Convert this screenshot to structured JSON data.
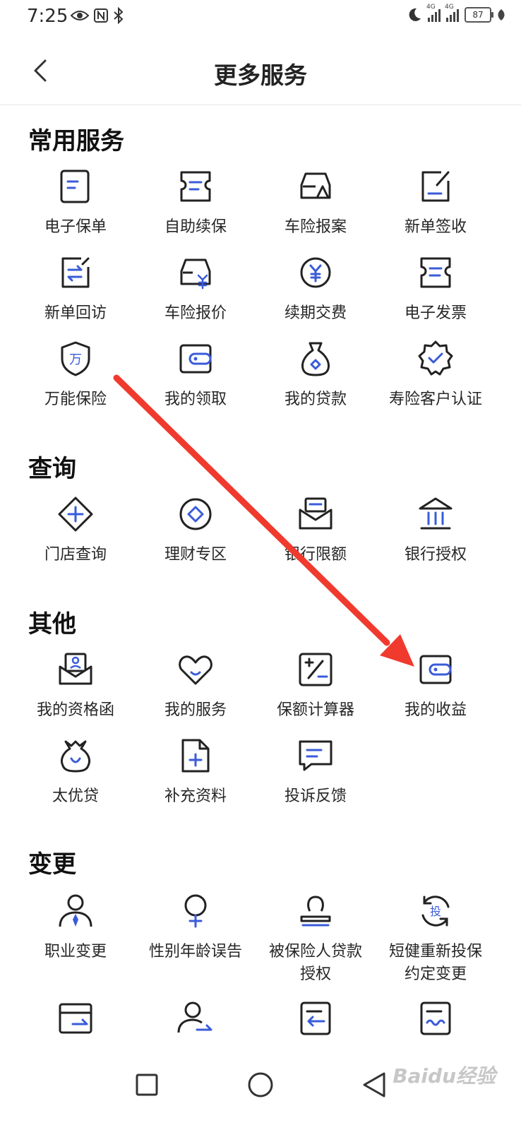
{
  "status": {
    "time": "7:25",
    "network": "4G",
    "battery": "87"
  },
  "header": {
    "title": "更多服务"
  },
  "sections": [
    {
      "title": "常用服务",
      "items": [
        {
          "label": "电子保单",
          "icon": "document-icon"
        },
        {
          "label": "自助续保",
          "icon": "ticket-icon"
        },
        {
          "label": "车险报案",
          "icon": "car-alert-icon"
        },
        {
          "label": "新单签收",
          "icon": "sign-document-icon"
        },
        {
          "label": "新单回访",
          "icon": "exchange-icon"
        },
        {
          "label": "车险报价",
          "icon": "car-price-icon"
        },
        {
          "label": "续期交费",
          "icon": "yuan-coin-icon"
        },
        {
          "label": "电子发票",
          "icon": "invoice-icon"
        },
        {
          "label": "万能保险",
          "icon": "shield-icon"
        },
        {
          "label": "我的领取",
          "icon": "wallet-icon"
        },
        {
          "label": "我的贷款",
          "icon": "money-bag-icon"
        },
        {
          "label": "寿险客户认证",
          "icon": "verified-badge-icon"
        }
      ]
    },
    {
      "title": "查询",
      "items": [
        {
          "label": "门店查询",
          "icon": "store-location-icon"
        },
        {
          "label": "理财专区",
          "icon": "diamond-icon"
        },
        {
          "label": "银行限额",
          "icon": "mail-card-icon"
        },
        {
          "label": "银行授权",
          "icon": "bank-icon"
        }
      ]
    },
    {
      "title": "其他",
      "items": [
        {
          "label": "我的资格函",
          "icon": "certificate-icon"
        },
        {
          "label": "我的服务",
          "icon": "heart-icon"
        },
        {
          "label": "保额计算器",
          "icon": "calculator-icon"
        },
        {
          "label": "我的收益",
          "icon": "wallet-icon"
        },
        {
          "label": "太优贷",
          "icon": "money-bag-icon"
        },
        {
          "label": "补充资料",
          "icon": "add-file-icon"
        },
        {
          "label": "投诉反馈",
          "icon": "chat-icon"
        }
      ]
    },
    {
      "title": "变更",
      "items": [
        {
          "label": "职业变更",
          "icon": "person-tie-icon"
        },
        {
          "label": "性别年龄误告",
          "icon": "gender-icon"
        },
        {
          "label": "被保险人贷款\n授权",
          "icon": "stamp-icon"
        },
        {
          "label": "短健重新投保\n约定变更",
          "icon": "refresh-invest-icon"
        },
        {
          "label": "",
          "icon": "card-transfer-icon"
        },
        {
          "label": "",
          "icon": "person-transfer-icon"
        },
        {
          "label": "",
          "icon": "document-return-icon"
        },
        {
          "label": "",
          "icon": "document-sign-icon"
        }
      ]
    }
  ],
  "watermark": "Baidu经验",
  "colors": {
    "accent": "#3a5bd9",
    "ink": "#222222",
    "arrow": "#f03a2e"
  }
}
